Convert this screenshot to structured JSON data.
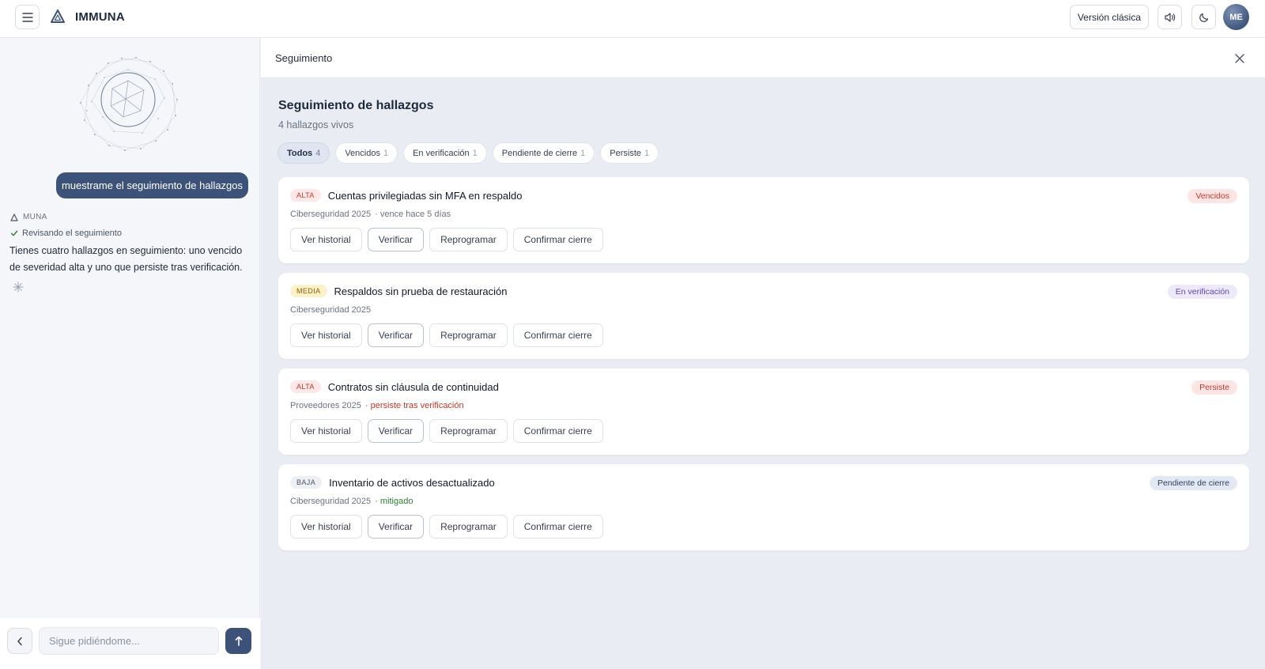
{
  "app": {
    "brand": "IMMUNA",
    "classic_version": "Versión clásica",
    "avatar_initials": "ME"
  },
  "chat": {
    "user_message": "muestrame el seguimiento de hallazgos",
    "assistant_name": "MUNA",
    "status": "Revisando el seguimiento",
    "assistant_message": "Tienes cuatro hallazgos en seguimiento: uno vencido de severidad alta y uno que persiste tras verificación.",
    "input_placeholder": "Sigue pidiéndome..."
  },
  "panel": {
    "header": "Seguimiento",
    "title": "Seguimiento de hallazgos",
    "subtitle": "4 hallazgos vivos",
    "filters": [
      {
        "label": "Todos",
        "count": "4"
      },
      {
        "label": "Vencidos",
        "count": "1"
      },
      {
        "label": "En verificación",
        "count": "1"
      },
      {
        "label": "Pendiente de cierre",
        "count": "1"
      },
      {
        "label": "Persiste",
        "count": "1"
      }
    ],
    "actions": {
      "history": "Ver historial",
      "verify": "Verificar",
      "reschedule": "Reprogramar",
      "confirm": "Confirmar cierre"
    },
    "findings": [
      {
        "severity": "ALTA",
        "title": "Cuentas privilegiadas sin MFA en respaldo",
        "source": "Ciberseguridad 2025",
        "note": "· vence hace 5 días",
        "status": "Vencidos"
      },
      {
        "severity": "MEDIA",
        "title": "Respaldos sin prueba de restauración",
        "source": "Ciberseguridad 2025",
        "note": "",
        "status": "En verificación"
      },
      {
        "severity": "ALTA",
        "title": "Contratos sin cláusula de continuidad",
        "source": "Proveedores 2025",
        "note": "· persiste tras verificación",
        "status": "Persiste"
      },
      {
        "severity": "BAJA",
        "title": "Inventario de activos desactualizado",
        "source": "Ciberseguridad 2025",
        "note": "· mitigado",
        "status": "Pendiente de cierre"
      }
    ]
  },
  "colors": {
    "accent": "#3d5278",
    "danger": "#c0392b",
    "success": "#2e7d32",
    "warning_bg": "#fdf1c9"
  },
  "icons": [
    "menu-icon",
    "brand-triangle-icon",
    "speaker-icon",
    "moon-icon",
    "close-icon",
    "check-icon",
    "sparkle-icon",
    "chevron-left-icon",
    "arrow-up-icon"
  ]
}
